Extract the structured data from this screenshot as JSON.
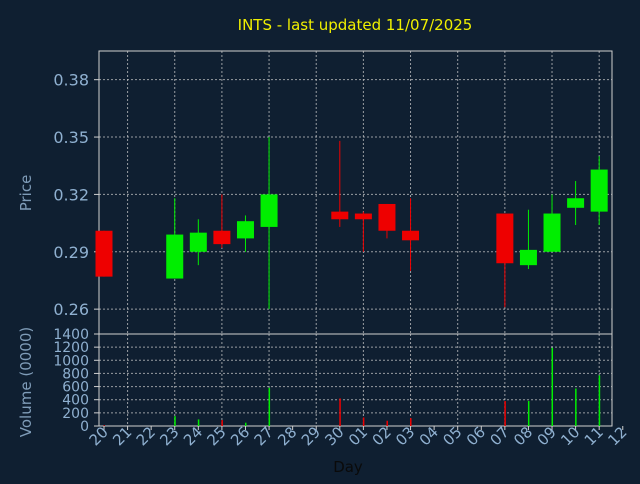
{
  "chart_data": {
    "type": "candlestick",
    "title": "INTS - last updated 11/07/2025",
    "xlabel": "Day",
    "ylabel": "Price",
    "volume_ylabel": "Volume (0000)",
    "grid": true,
    "colors": {
      "background": "#0f1f31",
      "up": "#00ee00",
      "down": "#ee0000",
      "grid": "#c8c8c8",
      "axis": "#d0d0d0",
      "title": "#f0f000",
      "label": "#7f9cb8",
      "tick": "#8fb0d0"
    },
    "price_axis": {
      "ylim": [
        0.247,
        0.395
      ],
      "ticks": [
        0.26,
        0.29,
        0.32,
        0.35,
        0.38
      ],
      "tick_labels": [
        "0.26",
        "0.29",
        "0.32",
        "0.35",
        "0.38"
      ]
    },
    "volume_axis": {
      "ylim": [
        0,
        1400
      ],
      "ticks": [
        0,
        200,
        400,
        600,
        800,
        1000,
        1200,
        1400
      ],
      "tick_labels": [
        "0",
        "200",
        "400",
        "600",
        "800",
        "1000",
        "1200",
        "1400"
      ]
    },
    "days": [
      "20",
      "21",
      "22",
      "23",
      "24",
      "25",
      "26",
      "27",
      "28",
      "29",
      "30",
      "01",
      "02",
      "03",
      "04",
      "05",
      "06",
      "07",
      "08",
      "09",
      "10",
      "11",
      "12"
    ],
    "candles": [
      {
        "day": "20",
        "open": 0.301,
        "high": 0.301,
        "low": 0.277,
        "close": 0.277,
        "volume": 10
      },
      {
        "day": "23",
        "open": 0.276,
        "high": 0.318,
        "low": 0.276,
        "close": 0.299,
        "volume": 150
      },
      {
        "day": "24",
        "open": 0.29,
        "high": 0.307,
        "low": 0.283,
        "close": 0.3,
        "volume": 100
      },
      {
        "day": "25",
        "open": 0.301,
        "high": 0.32,
        "low": 0.292,
        "close": 0.294,
        "volume": 90
      },
      {
        "day": "26",
        "open": 0.297,
        "high": 0.309,
        "low": 0.29,
        "close": 0.306,
        "volume": 50
      },
      {
        "day": "27",
        "open": 0.303,
        "high": 0.35,
        "low": 0.26,
        "close": 0.32,
        "volume": 580
      },
      {
        "day": "30",
        "open": 0.311,
        "high": 0.348,
        "low": 0.303,
        "close": 0.307,
        "volume": 420
      },
      {
        "day": "01",
        "open": 0.31,
        "high": 0.311,
        "low": 0.29,
        "close": 0.307,
        "volume": 130
      },
      {
        "day": "02",
        "open": 0.315,
        "high": 0.315,
        "low": 0.297,
        "close": 0.301,
        "volume": 80
      },
      {
        "day": "03",
        "open": 0.301,
        "high": 0.318,
        "low": 0.28,
        "close": 0.296,
        "volume": 120
      },
      {
        "day": "07",
        "open": 0.31,
        "high": 0.31,
        "low": 0.261,
        "close": 0.284,
        "volume": 380
      },
      {
        "day": "08",
        "open": 0.283,
        "high": 0.312,
        "low": 0.281,
        "close": 0.291,
        "volume": 380
      },
      {
        "day": "09",
        "open": 0.29,
        "high": 0.32,
        "low": 0.29,
        "close": 0.31,
        "volume": 1190
      },
      {
        "day": "10",
        "open": 0.313,
        "high": 0.327,
        "low": 0.304,
        "close": 0.318,
        "volume": 570
      },
      {
        "day": "11",
        "open": 0.311,
        "high": 0.34,
        "low": 0.304,
        "close": 0.333,
        "volume": 770
      }
    ]
  }
}
